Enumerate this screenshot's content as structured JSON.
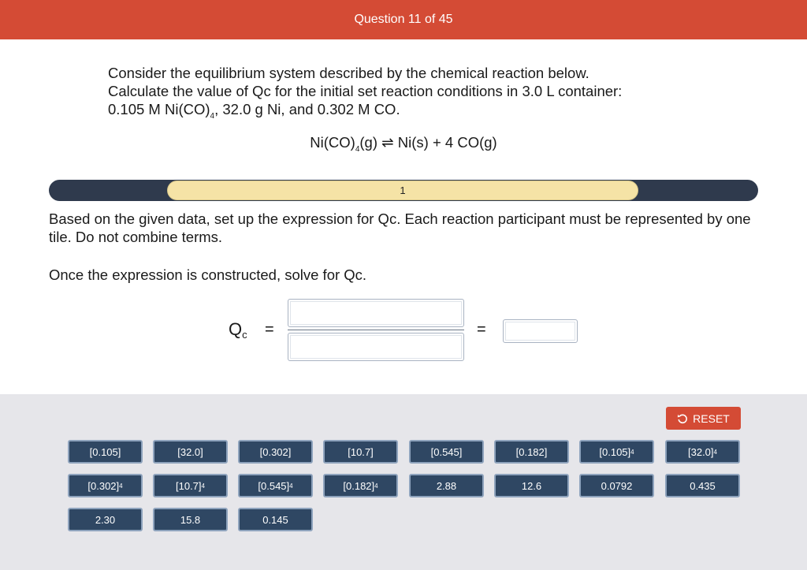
{
  "header": {
    "title": "Question 11 of 45"
  },
  "problem": {
    "line1": "Consider the equilibrium system described by the chemical reaction below.",
    "line2": "Calculate the value of Qc for the initial set reaction conditions in 3.0 L container:",
    "line3_a": "0.105 M Ni(CO)",
    "line3_sub": "4",
    "line3_b": ", 32.0 g Ni, and 0.302 M CO."
  },
  "reaction": {
    "part_a": "Ni(CO)",
    "part_sub": "4",
    "part_b": "(g) ⇌ Ni(s) + 4 CO(g)"
  },
  "progress": {
    "step_label": "1"
  },
  "instructions": {
    "p1": "Based on the given data, set up the expression for Qc. Each reaction participant must be represented by one tile. Do not combine terms.",
    "p2": "Once the expression is constructed, solve for Qc."
  },
  "expression": {
    "q": "Q",
    "q_sub": "c",
    "equals": "=",
    "equals2": "="
  },
  "reset": {
    "label": "RESET",
    "icon": "undo-icon"
  },
  "tiles": [
    {
      "base": "[0.105]",
      "exp": ""
    },
    {
      "base": "[32.0]",
      "exp": ""
    },
    {
      "base": "[0.302]",
      "exp": ""
    },
    {
      "base": "[10.7]",
      "exp": ""
    },
    {
      "base": "[0.545]",
      "exp": ""
    },
    {
      "base": "[0.182]",
      "exp": ""
    },
    {
      "base": "[0.105]",
      "exp": "4"
    },
    {
      "base": "[32.0]",
      "exp": "4"
    },
    {
      "base": "[0.302]",
      "exp": "4"
    },
    {
      "base": "[10.7]",
      "exp": "4"
    },
    {
      "base": "[0.545]",
      "exp": "4"
    },
    {
      "base": "[0.182]",
      "exp": "4"
    },
    {
      "base": "2.88",
      "exp": ""
    },
    {
      "base": "12.6",
      "exp": ""
    },
    {
      "base": "0.0792",
      "exp": ""
    },
    {
      "base": "0.435",
      "exp": ""
    },
    {
      "base": "2.30",
      "exp": ""
    },
    {
      "base": "15.8",
      "exp": ""
    },
    {
      "base": "0.145",
      "exp": ""
    }
  ],
  "colors": {
    "header": "#d44b35",
    "tile": "#2f4763",
    "track": "#2f3a4d",
    "step": "#f5e3a6"
  }
}
